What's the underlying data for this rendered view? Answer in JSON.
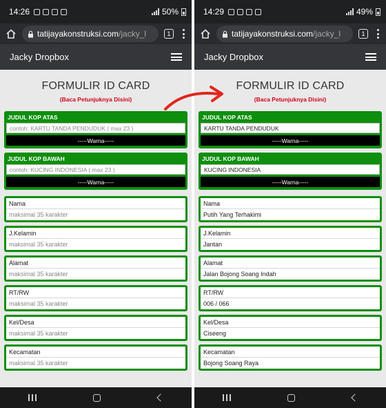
{
  "left": {
    "status": {
      "time": "14:26",
      "battery": "50%"
    },
    "browser": {
      "url_host": "tatijayakonstruksi.com",
      "url_path": "/jacky_l",
      "tab_count": "1"
    },
    "site": {
      "brand": "Jacky Dropbox"
    },
    "form": {
      "title": "FORMULIR ID CARD",
      "link": "(Baca Petunjuknya Disini)",
      "kop_atas": {
        "label": "JUDUL KOP ATAS",
        "placeholder": "contoh: KARTU TANDA PENDUDUK ( max 23 )",
        "value": "",
        "color_label": "-----Warna-----"
      },
      "kop_bawah": {
        "label": "JUDUL KOP BAWAH",
        "placeholder": "contoh: KUCING INDONESIA ( max 23 )",
        "value": "",
        "color_label": "-----Warna-----"
      },
      "fields": [
        {
          "label": "Nama",
          "placeholder": "maksimal 35 karakter",
          "value": ""
        },
        {
          "label": "J.Kelamin",
          "placeholder": "maksimal 35 karakter",
          "value": ""
        },
        {
          "label": "Alamat",
          "placeholder": "maksimal 35 karakter",
          "value": ""
        },
        {
          "label": "RT/RW",
          "placeholder": "maksimal 35 karakter",
          "value": ""
        },
        {
          "label": "Kel/Desa",
          "placeholder": "maksimal 35 karakter",
          "value": ""
        },
        {
          "label": "Kecamatan",
          "placeholder": "maksimal 35 karakter",
          "value": ""
        }
      ]
    }
  },
  "right": {
    "status": {
      "time": "14:29",
      "battery": "49%"
    },
    "browser": {
      "url_host": "tatijayakonstruksi.com",
      "url_path": "/jacky_l",
      "tab_count": "1"
    },
    "site": {
      "brand": "Jacky Dropbox"
    },
    "form": {
      "title": "FORMULIR ID CARD",
      "link": "(Baca Petunjuknya Disini)",
      "kop_atas": {
        "label": "JUDUL KOP ATAS",
        "placeholder": "",
        "value": "KARTU TANDA PENDUDUK",
        "color_label": "-----Warna-----"
      },
      "kop_bawah": {
        "label": "JUDUL KOP BAWAH",
        "placeholder": "",
        "value": "KUCING INDONESIA",
        "color_label": "-----Warna-----"
      },
      "fields": [
        {
          "label": "Nama",
          "placeholder": "",
          "value": "Putih Yang Terhakimi"
        },
        {
          "label": "J.Kelamin",
          "placeholder": "",
          "value": "Jantan"
        },
        {
          "label": "Alamat",
          "placeholder": "",
          "value": "Jalan Bojong Soang Indah"
        },
        {
          "label": "RT/RW",
          "placeholder": "",
          "value": "006 / 066"
        },
        {
          "label": "Kel/Desa",
          "placeholder": "",
          "value": "Ciseeng"
        },
        {
          "label": "Kecamatan",
          "placeholder": "",
          "value": "Bojong Soang Raya"
        }
      ]
    }
  },
  "colors": {
    "green": "#0d8f0d",
    "link_red": "#d0021b",
    "arrow_red": "#e0261d"
  },
  "icons": [
    "home-icon",
    "lock-icon",
    "tabs-icon",
    "more-icon",
    "hamburger-icon",
    "arrow-icon"
  ]
}
